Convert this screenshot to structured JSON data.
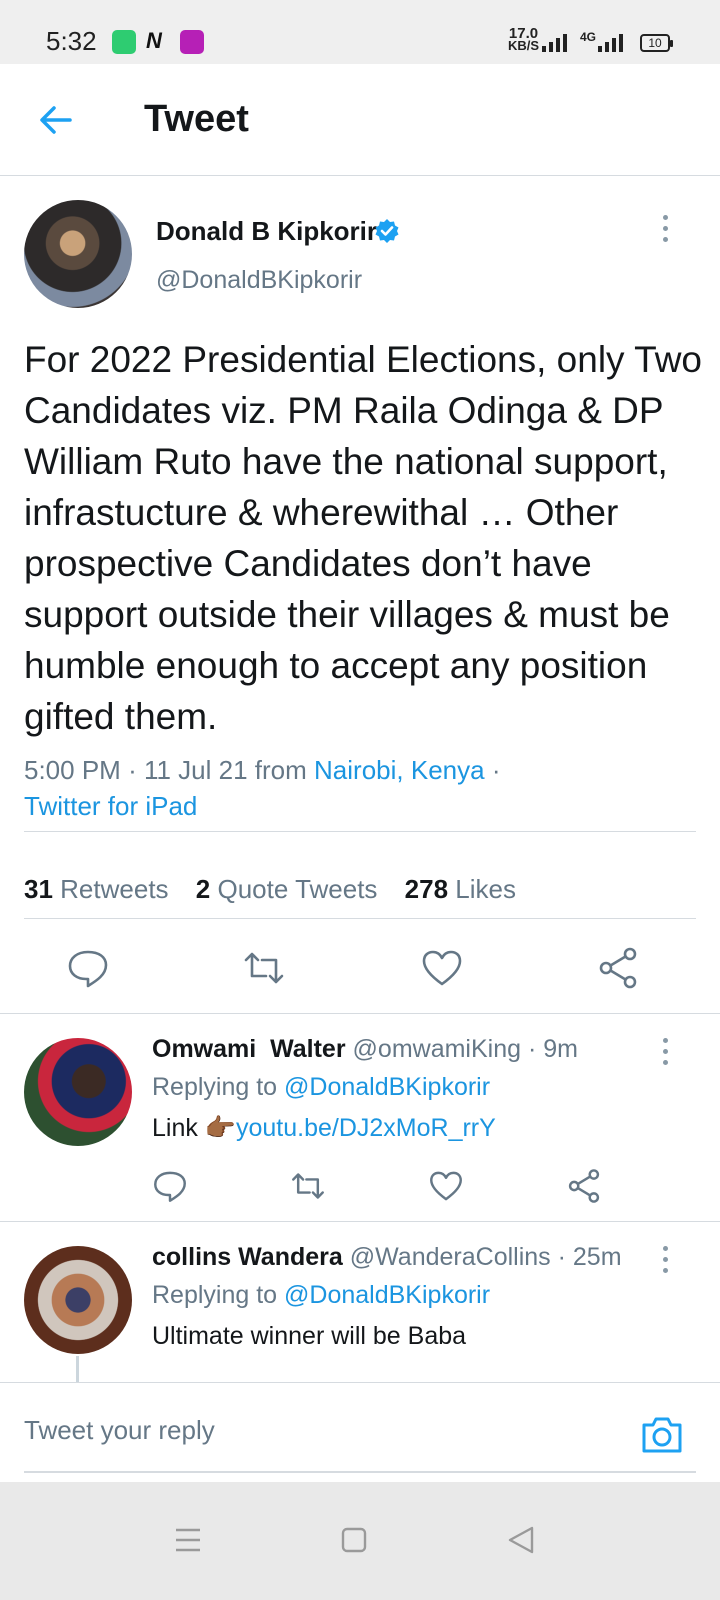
{
  "status_bar": {
    "time": "5:32",
    "net_speed_value": "17.0",
    "net_speed_unit": "KB/S",
    "network_type": "4G",
    "battery": "10"
  },
  "header": {
    "title": "Tweet"
  },
  "tweet": {
    "author_name": "Donald B Kipkorir",
    "author_handle": "@DonaldBKipkorir",
    "text": "For 2022 Presidential Elections, only Two Candidates viz. PM Raila Odinga & DP William Ruto have the national support, infrastucture & wherewithal … Other prospective Candidates don’t have support outside their villages & must be humble enough to accept any position gifted them.",
    "time": "5:00 PM",
    "date": "11 Jul 21",
    "from_label": "from",
    "location": "Nairobi, Kenya",
    "source": "Twitter for iPad",
    "separator": "·",
    "stats": {
      "retweets_count": "31",
      "retweets_label": "Retweets",
      "quotes_count": "2",
      "quotes_label": "Quote Tweets",
      "likes_count": "278",
      "likes_label": "Likes"
    }
  },
  "replies": [
    {
      "name": "Omwami  Walter",
      "handle": "@omwamiKing",
      "age": "9m",
      "replying_label": "Replying to",
      "replying_handle": "@DonaldBKipkorir",
      "text_prefix": "Link",
      "emoji": "👉🏾",
      "link": "youtu.be/DJ2xMoR_rrY"
    },
    {
      "name": "collins Wandera",
      "handle": "@WanderaCollins",
      "age": "25m",
      "replying_label": "Replying to",
      "replying_handle": "@DonaldBKipkorir",
      "text": "Ultimate winner will be Baba"
    }
  ],
  "composer": {
    "placeholder": "Tweet your reply"
  },
  "colors": {
    "accent": "#1da1f2",
    "link": "#1b95e0",
    "muted": "#657786",
    "text": "#14171a"
  }
}
